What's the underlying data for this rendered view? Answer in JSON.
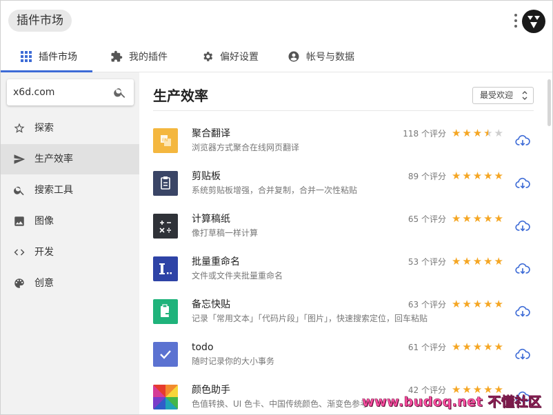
{
  "header": {
    "app_title": "插件市场",
    "menu_icon": "more-vertical-icon",
    "logo_icon": "utools-logo-icon"
  },
  "tabs": [
    {
      "label": "插件市场",
      "icon": "grid-icon",
      "active": true
    },
    {
      "label": "我的插件",
      "icon": "puzzle-icon",
      "active": false
    },
    {
      "label": "偏好设置",
      "icon": "gear-icon",
      "active": false
    },
    {
      "label": "帐号与数据",
      "icon": "account-icon",
      "active": false
    }
  ],
  "search": {
    "value": "x6d.com",
    "icon": "search-icon"
  },
  "sidebar": {
    "items": [
      {
        "label": "探索",
        "icon": "star-outline-icon",
        "active": false
      },
      {
        "label": "生产效率",
        "icon": "send-icon",
        "active": true
      },
      {
        "label": "搜索工具",
        "icon": "search-icon",
        "active": false
      },
      {
        "label": "图像",
        "icon": "image-icon",
        "active": false
      },
      {
        "label": "开发",
        "icon": "code-icon",
        "active": false
      },
      {
        "label": "创意",
        "icon": "palette-icon",
        "active": false
      }
    ]
  },
  "main": {
    "title": "生产效率",
    "sort": {
      "selected": "最受欢迎"
    },
    "plugins": [
      {
        "name": "聚合翻译",
        "desc": "浏览器方式聚合在线网页翻译",
        "count": "118 个评分",
        "rating": 3.5,
        "icon": "translate-icon",
        "color": "#f4b73f"
      },
      {
        "name": "剪贴板",
        "desc": "系统剪贴板增强，合并复制，合并一次性粘贴",
        "count": "89 个评分",
        "rating": 5,
        "icon": "clipboard-icon",
        "color": "#3a4566"
      },
      {
        "name": "计算稿纸",
        "desc": "像打草稿一样计算",
        "count": "65 个评分",
        "rating": 5,
        "icon": "calculator-icon",
        "color": "#2f3238"
      },
      {
        "name": "批量重命名",
        "desc": "文件或文件夹批量重命名",
        "count": "53 个评分",
        "rating": 5,
        "icon": "rename-icon",
        "color": "#2e43a6"
      },
      {
        "name": "备忘快贴",
        "desc": "记录「常用文本」「代码片段」「图片」，快速搜索定位，回车粘贴",
        "count": "63 个评分",
        "rating": 5,
        "icon": "memo-paste-icon",
        "color": "#1fb37b"
      },
      {
        "name": "todo",
        "desc": "随时记录你的大小事务",
        "count": "61 个评分",
        "rating": 5,
        "icon": "check-icon",
        "color": "#5b72d1"
      },
      {
        "name": "颜色助手",
        "desc": "色值转换、UI 色卡、中国传统颜色、渐变色参考",
        "count": "42 个评分",
        "rating": 5,
        "icon": "color-wheel-icon",
        "color": "#e63b2e"
      }
    ]
  },
  "colors": {
    "accent": "#3d6bd6",
    "star": "#f5a623",
    "star_empty": "#cfcfcf",
    "download": "#3d6bd6"
  },
  "watermark": "www.budoq.net 不懂社区"
}
